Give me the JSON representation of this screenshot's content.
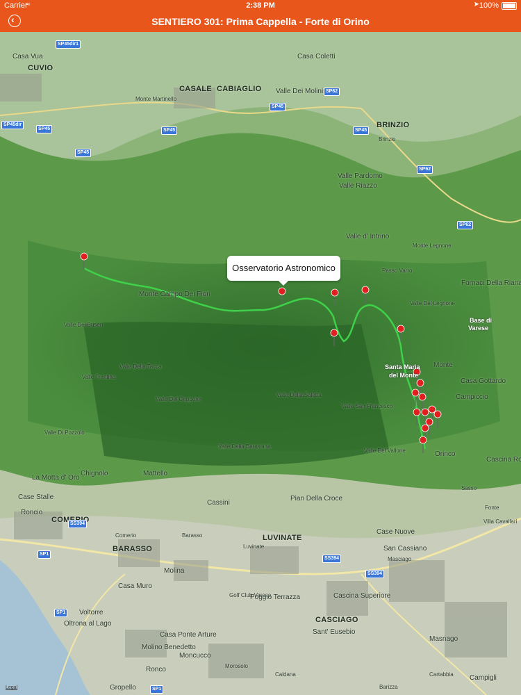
{
  "status_bar": {
    "carrier": "Carrier",
    "time": "2:38 PM",
    "battery": "100%"
  },
  "nav": {
    "title": "SENTIERO 301: Prima Cappella - Forte di Orino"
  },
  "map": {
    "callout": "Osservatorio Astronomico",
    "legal": "Legal",
    "places": [
      "Casa Vua",
      "CUVIO",
      "Casa Coletti",
      "CASALE",
      "CABIAGLIO",
      "Monte Martinello",
      "Valle Dei Molini",
      "BRINZIO",
      "Brinzio",
      "Valle Pardomo",
      "Valle Riazzo",
      "Valle d' Intrino",
      "Monte Legnone",
      "Passo Varro",
      "Fornaci Della Riana",
      "Valle Del Legnone",
      "Base di",
      "Varese",
      "Monte Campo Dei Fiori",
      "Valle Dei Busen",
      "Valle Della Tacca",
      "Valle Trentina",
      "Valle Del Ceppone",
      "Valle Della Saletta",
      "Valle San Francesco",
      "Santa Maria",
      "del Monte",
      "Monte",
      "Casa Gottardo",
      "Campiccio",
      "Valle Di Pozzolo",
      "Valle Del Vallone",
      "Valle Della Barassina",
      "Orinco",
      "Cascina Rosa",
      "Chignolo",
      "Mattello",
      "La Motta d' Oro",
      "Case Stalle",
      "Cassini",
      "Pian Della Croce",
      "Roncio",
      "COMERIO",
      "Comerio",
      "BARASSO",
      "Barasso",
      "LUVINATE",
      "Luvinate",
      "Case Nuove",
      "San Cassiano",
      "Molina",
      "Masciago",
      "Casa Muro",
      "Golf Club Varese",
      "Poggio Terrazza",
      "Cascina Superiore",
      "Voltorre",
      "Oltrona al Lago",
      "CASCIAGO",
      "Sant' Eusebio",
      "Casa Ponte Arture",
      "Molino Benedetto",
      "Moncucco",
      "Ronco",
      "Morosolo",
      "Masnago",
      "Campigli",
      "Gropello",
      "Caldana",
      "Barizza",
      "Cartabbia",
      "Villa Cavallari",
      "Sasso",
      "Fonte"
    ],
    "road_shields": [
      "SP45dir1",
      "SP45",
      "SP45dir",
      "SP62",
      "SS394",
      "SP1",
      "SP45dir1"
    ],
    "route_color": "#3fd14a",
    "pin_color": "#e11f1f"
  }
}
